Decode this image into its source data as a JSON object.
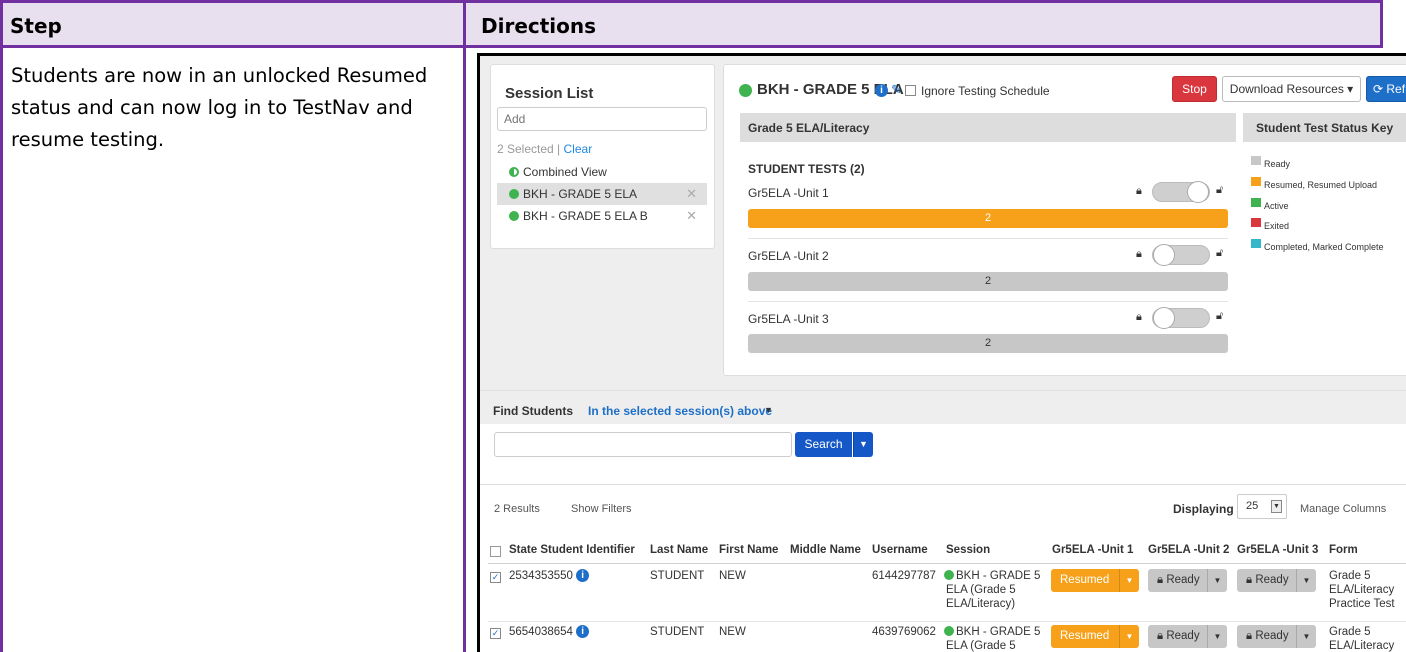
{
  "doc": {
    "col_step": "Step",
    "col_directions": "Directions",
    "step_text": "Students are now in an unlocked Resumed status and can now log in to TestNav and resume testing."
  },
  "session_list": {
    "title": "Session List",
    "add_placeholder": "Add",
    "selected_count": "2 Selected |",
    "clear_label": "Clear",
    "items": [
      {
        "label": "Combined View"
      },
      {
        "label": "BKH - GRADE 5 ELA"
      },
      {
        "label": "BKH - GRADE 5 ELA B"
      }
    ]
  },
  "session": {
    "title": "BKH - GRADE 5 ELA",
    "ignore_label": "Ignore Testing Schedule",
    "stop_label": "Stop",
    "download_label": "Download Resources ▾",
    "refresh_label": "⟳ Refresh",
    "grade_header": "Grade 5 ELA/Literacy",
    "student_tests_header": "STUDENT TESTS (2)",
    "units": [
      {
        "label": "Gr5ELA -Unit 1",
        "count": "2"
      },
      {
        "label": "Gr5ELA -Unit 2",
        "count": "2"
      },
      {
        "label": "Gr5ELA -Unit 3",
        "count": "2"
      }
    ],
    "status_key_header": "Student Test Status Key",
    "status_key": [
      {
        "label": "Ready",
        "color": "#c7c7c7"
      },
      {
        "label": "Resumed, Resumed Upload",
        "color": "#f7a11a"
      },
      {
        "label": "Active",
        "color": "#3fb34f"
      },
      {
        "label": "Exited",
        "color": "#d9363e"
      },
      {
        "label": "Completed, Marked Complete",
        "color": "#36b7c9"
      }
    ]
  },
  "find": {
    "label": "Find Students",
    "scope": "In the selected session(s) above",
    "search_label": "Search"
  },
  "results": {
    "count": "2 Results",
    "show_filters": "Show Filters",
    "displaying_label": "Displaying",
    "per_page": "25",
    "manage_columns": "Manage Columns"
  },
  "table": {
    "headers": [
      "State Student Identifier",
      "Last Name",
      "First Name",
      "Middle Name",
      "Username",
      "Session",
      "Gr5ELA -Unit 1",
      "Gr5ELA -Unit 2",
      "Gr5ELA -Unit 3",
      "Form"
    ],
    "rows": [
      {
        "id": "2534353550",
        "last": "STUDENT",
        "first": "NEW",
        "username": "6144297787",
        "session_l1": "BKH - GRADE 5",
        "session_l2": "ELA (Grade 5",
        "session_l3": "ELA/Literacy)",
        "unit1": "Resumed",
        "unit2": "Ready",
        "unit3": "Ready",
        "form_l1": "Grade 5",
        "form_l2": "ELA/Literacy",
        "form_l3": "Practice Test"
      },
      {
        "id": "5654038654",
        "last": "STUDENT",
        "first": "NEW",
        "username": "4639769062",
        "session_l1": "BKH - GRADE 5",
        "session_l2": "ELA (Grade 5",
        "unit1": "Resumed",
        "unit2": "Ready",
        "unit3": "Ready",
        "form_l1": "Grade 5",
        "form_l2": "ELA/Literacy"
      }
    ]
  }
}
